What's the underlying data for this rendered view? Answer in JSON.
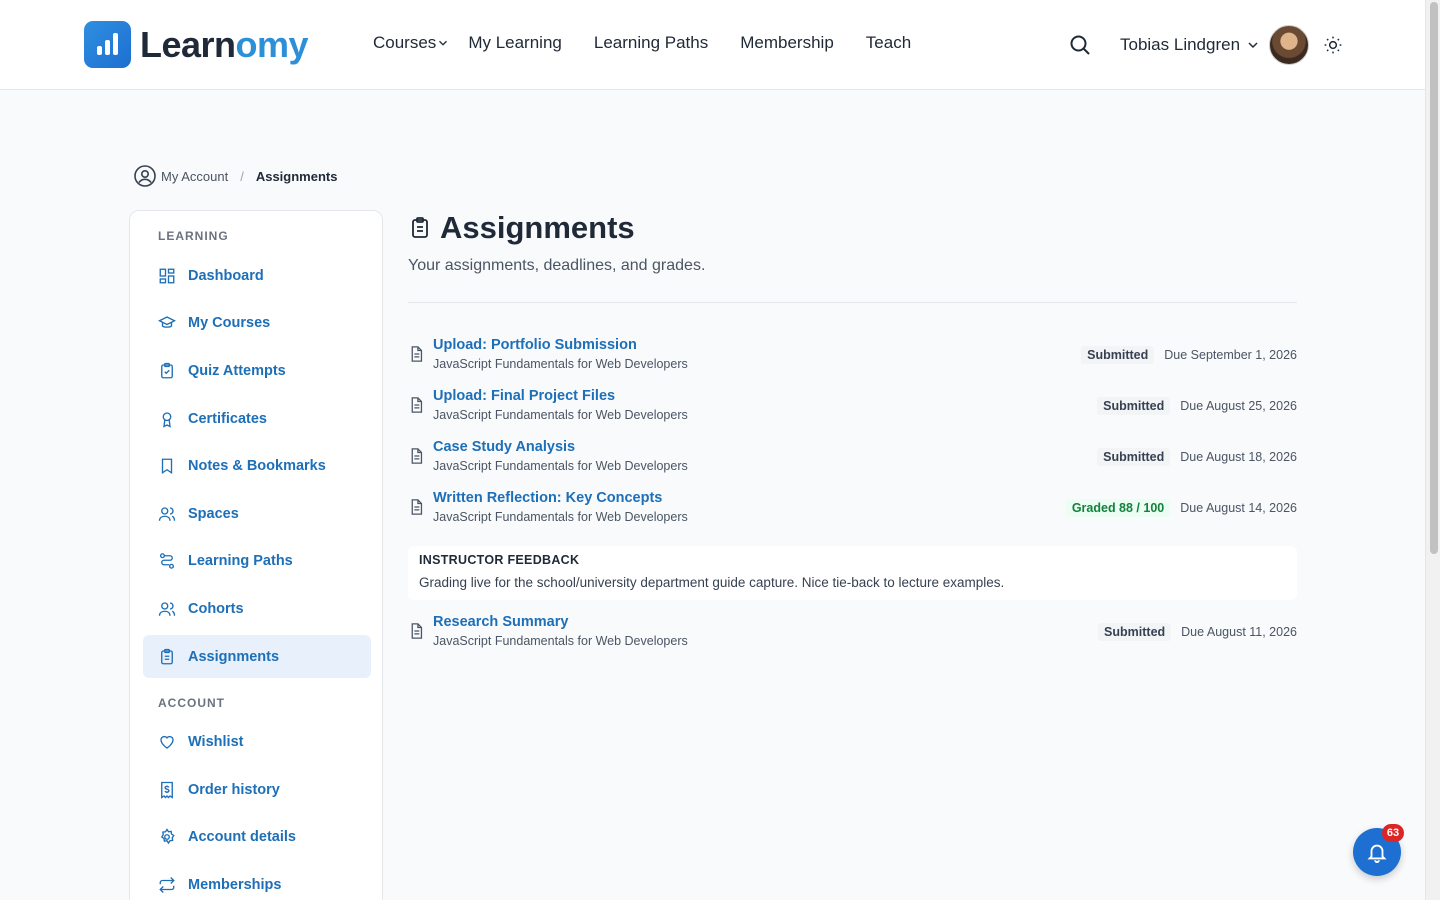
{
  "header": {
    "logo": {
      "part1": "Learn",
      "part2": "omy"
    },
    "nav": [
      "Courses",
      "My Learning",
      "Learning Paths",
      "Membership",
      "Teach"
    ],
    "user_name": "Tobias Lindgren"
  },
  "breadcrumb": {
    "parent": "My Account",
    "current": "Assignments"
  },
  "sidebar": {
    "learning_heading": "LEARNING",
    "learning_items": [
      {
        "label": "Dashboard",
        "icon": "dashboard-icon"
      },
      {
        "label": "My Courses",
        "icon": "graduation-cap-icon"
      },
      {
        "label": "Quiz Attempts",
        "icon": "clipboard-check-icon"
      },
      {
        "label": "Certificates",
        "icon": "award-icon"
      },
      {
        "label": "Notes & Bookmarks",
        "icon": "bookmark-icon"
      },
      {
        "label": "Spaces",
        "icon": "users-icon"
      },
      {
        "label": "Learning Paths",
        "icon": "route-icon"
      },
      {
        "label": "Cohorts",
        "icon": "users-icon"
      },
      {
        "label": "Assignments",
        "icon": "clipboard-list-icon"
      }
    ],
    "account_heading": "ACCOUNT",
    "account_items": [
      {
        "label": "Wishlist",
        "icon": "heart-icon"
      },
      {
        "label": "Order history",
        "icon": "receipt-icon"
      },
      {
        "label": "Account details",
        "icon": "gear-icon"
      },
      {
        "label": "Memberships",
        "icon": "repeat-icon"
      }
    ]
  },
  "main": {
    "title": "Assignments",
    "subtitle": "Your assignments, deadlines, and grades.",
    "assignments": [
      {
        "title": "Upload: Portfolio Submission",
        "course": "JavaScript Fundamentals for Web Developers",
        "status": "Submitted",
        "due": "Due September 1, 2026"
      },
      {
        "title": "Upload: Final Project Files",
        "course": "JavaScript Fundamentals for Web Developers",
        "status": "Submitted",
        "due": "Due August 25, 2026"
      },
      {
        "title": "Case Study Analysis",
        "course": "JavaScript Fundamentals for Web Developers",
        "status": "Submitted",
        "due": "Due August 18, 2026"
      },
      {
        "title": "Written Reflection: Key Concepts",
        "course": "JavaScript Fundamentals for Web Developers",
        "status": "Graded 88 / 100",
        "due": "Due August 14, 2026"
      },
      {
        "title": "Research Summary",
        "course": "JavaScript Fundamentals for Web Developers",
        "status": "Submitted",
        "due": "Due August 11, 2026"
      }
    ],
    "feedback": {
      "label": "INSTRUCTOR FEEDBACK",
      "text": "Grading live for the school/university department guide capture. Nice tie-back to lecture examples."
    }
  },
  "notifications": {
    "count": "63"
  },
  "colors": {
    "accent": "#1d6fb8",
    "brand": "#2d8fd8",
    "graded": "#15803d",
    "badge_alert": "#dc2626"
  }
}
